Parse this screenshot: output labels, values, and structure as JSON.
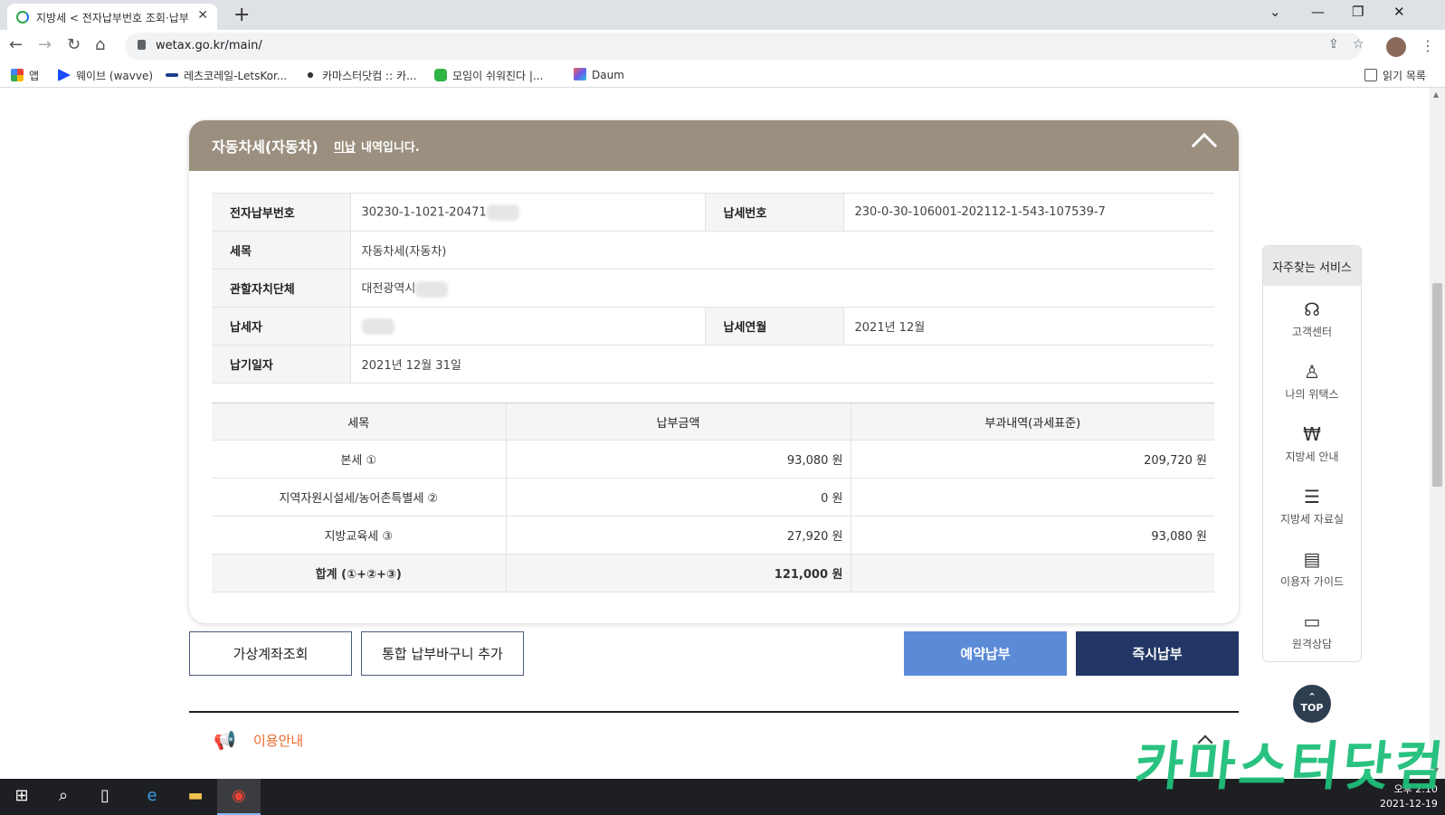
{
  "browser": {
    "tab_title": "지방세 < 전자납부번호 조회·납부",
    "tab_close": "✕",
    "new_tab": "+",
    "url": "wetax.go.kr/main/",
    "bookmarks": [
      {
        "label": "앱",
        "color": "#e94335"
      },
      {
        "label": "웨이브 (wavve)",
        "color": "#1a4dff"
      },
      {
        "label": "레츠코레일-LetsKor...",
        "color": "#1c3c8c"
      },
      {
        "label": "카마스터닷컴 :: 카...",
        "color": "#333333"
      },
      {
        "label": "모임이 쉬워진다 |...",
        "color": "#2fb344"
      },
      {
        "label": "Daum",
        "color": "#6c5ce7"
      }
    ],
    "reading_list": "읽기 목록"
  },
  "card": {
    "title": "자동차세(자동차)",
    "status": "미납",
    "suffix": "내역입니다."
  },
  "info": {
    "epay_no_label": "전자납부번호",
    "epay_no_value": "30230-1-1021-20471",
    "tax_no_label": "납세번호",
    "tax_no_value": "230-0-30-106001-202112-1-543-107539-7",
    "item_label": "세목",
    "item_value": "자동차세(자동차)",
    "authority_label": "관할자치단체",
    "authority_value": "대전광역시",
    "taxpayer_label": "납세자",
    "period_label": "납세연월",
    "period_value": "2021년 12월",
    "due_label": "납기일자",
    "due_value": "2021년 12월 31일"
  },
  "amounts": {
    "headers": [
      "세목",
      "납부금액",
      "부과내역(과세표준)"
    ],
    "rows": [
      {
        "item": "본세 ①",
        "amount": "93,080 원",
        "base": "209,720 원"
      },
      {
        "item": "지역자원시설세/농어촌특별세 ②",
        "amount": "0 원",
        "base": ""
      },
      {
        "item": "지방교육세 ③",
        "amount": "27,920 원",
        "base": "93,080 원"
      }
    ],
    "total": {
      "item": "합계 (①+②+③)",
      "amount": "121,000 원",
      "base": ""
    }
  },
  "buttons": {
    "virtual_account": "가상계좌조회",
    "add_cart": "통합 납부바구니 추가",
    "reserve_pay": "예약납부",
    "pay_now": "즉시납부"
  },
  "usage": {
    "label": "이용안내"
  },
  "quick": {
    "title": "자주찾는 서비스",
    "items": [
      {
        "label": "고객센터",
        "icon": "headset-icon"
      },
      {
        "label": "나의 위택스",
        "icon": "person-icon"
      },
      {
        "label": "지방세 안내",
        "icon": "money-bag-icon"
      },
      {
        "label": "지방세 자료실",
        "icon": "list-icon"
      },
      {
        "label": "이용자 가이드",
        "icon": "chat-icon"
      },
      {
        "label": "원격상담",
        "icon": "monitor-icon"
      }
    ],
    "top": "TOP"
  },
  "taskbar": {
    "time": "오후 2:10",
    "date": "2021-12-19"
  },
  "watermark": "카마스터닷컴",
  "colors": {
    "card_header": "#9b9080",
    "reserve_btn": "#5b8ad6",
    "pay_btn": "#223765",
    "usage_accent": "#e86a2c",
    "watermark": "#1fbf7a"
  }
}
